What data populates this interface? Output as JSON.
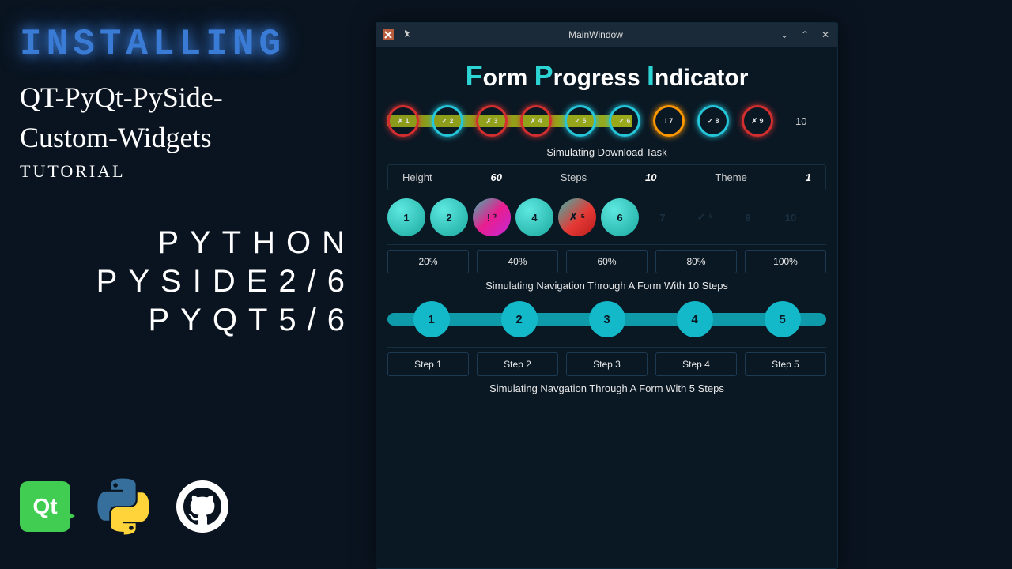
{
  "left": {
    "installing": "INSTALLING",
    "pkg_line1": "QT-PyQt-PySide-",
    "pkg_line2": "Custom-Widgets",
    "tutorial": "TUTORIAL",
    "tech1": "PYTHON",
    "tech2": "PYSIDE2/6",
    "tech3": "PYQT5/6",
    "qt_label": "Qt"
  },
  "window": {
    "title": "MainWindow",
    "heading_f": "F",
    "heading_orm": "orm ",
    "heading_p": "P",
    "heading_rogress": "rogress ",
    "heading_i": "I",
    "heading_ndicator": "ndicator"
  },
  "row1": {
    "steps": [
      {
        "icon": "✗",
        "n": "1",
        "ring": "red"
      },
      {
        "icon": "✓",
        "n": "2",
        "ring": "cyan"
      },
      {
        "icon": "✗",
        "n": "3",
        "ring": "red"
      },
      {
        "icon": "✗",
        "n": "4",
        "ring": "red"
      },
      {
        "icon": "✓",
        "n": "5",
        "ring": "cyan"
      },
      {
        "icon": "✓",
        "n": "6",
        "ring": "cyan"
      },
      {
        "icon": "!",
        "n": "7",
        "ring": "orange"
      },
      {
        "icon": "✓",
        "n": "8",
        "ring": "cyan"
      },
      {
        "icon": "✗",
        "n": "9",
        "ring": "red"
      }
    ],
    "end": "10",
    "caption": "Simulating Download Task"
  },
  "params": {
    "height_label": "Height",
    "height_val": "60",
    "steps_label": "Steps",
    "steps_val": "10",
    "theme_label": "Theme",
    "theme_val": "1"
  },
  "row2": {
    "balls": [
      {
        "text": "1",
        "cls": "teal"
      },
      {
        "text": "2",
        "cls": "teal"
      },
      {
        "text": "! ³",
        "cls": "pink"
      },
      {
        "text": "4",
        "cls": "teal"
      },
      {
        "text": "✗ ⁵",
        "cls": "red"
      },
      {
        "text": "6",
        "cls": "teal"
      },
      {
        "text": "7",
        "cls": "dim"
      },
      {
        "text": "✓ ⁸",
        "cls": "dim"
      },
      {
        "text": "9",
        "cls": "dim"
      },
      {
        "text": "10",
        "cls": "dim"
      }
    ]
  },
  "pct": [
    "20%",
    "40%",
    "60%",
    "80%",
    "100%"
  ],
  "row3": {
    "caption": "Simulating Navigation Through A Form With 10 Steps",
    "steps": [
      "1",
      "2",
      "3",
      "4",
      "5"
    ]
  },
  "steps_btns": [
    "Step 1",
    "Step 2",
    "Step 3",
    "Step 4",
    "Step 5"
  ],
  "caption_5": "Simulating Navgation Through A Form With 5 Steps"
}
